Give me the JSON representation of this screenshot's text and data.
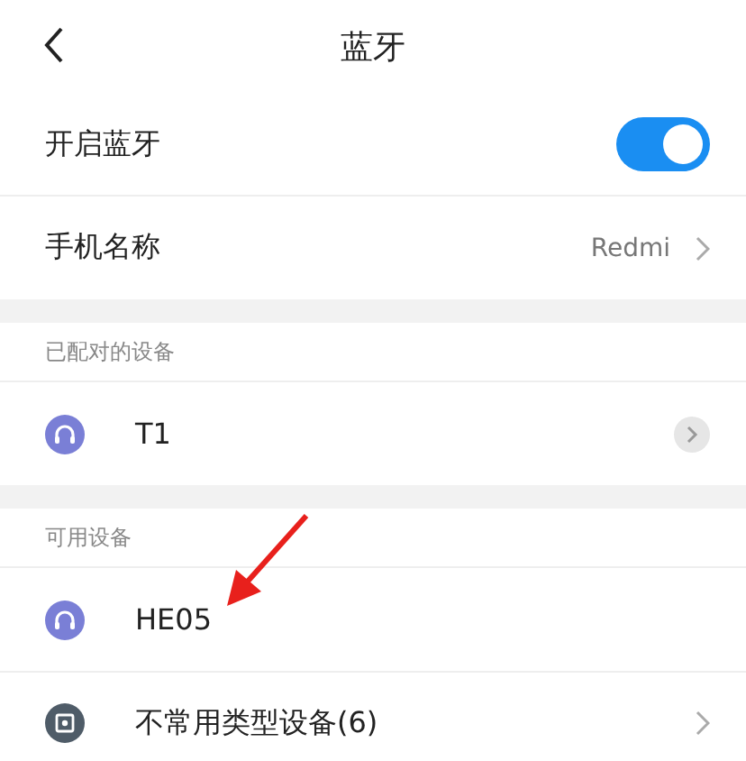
{
  "header": {
    "title": "蓝牙"
  },
  "settings": [
    {
      "kind": "toggle",
      "label": "开启蓝牙",
      "on": true
    },
    {
      "kind": "value",
      "label": "手机名称",
      "value": "Redmi"
    }
  ],
  "sections": [
    {
      "title": "已配对的设备",
      "devices": [
        {
          "name": "T1",
          "kind": "paired"
        }
      ]
    },
    {
      "title": "可用设备",
      "devices": [
        {
          "name": "HE05",
          "kind": "available"
        },
        {
          "name": "不常用类型设备(6)",
          "kind": "group"
        }
      ]
    }
  ],
  "annotation": {
    "kind": "arrow"
  }
}
